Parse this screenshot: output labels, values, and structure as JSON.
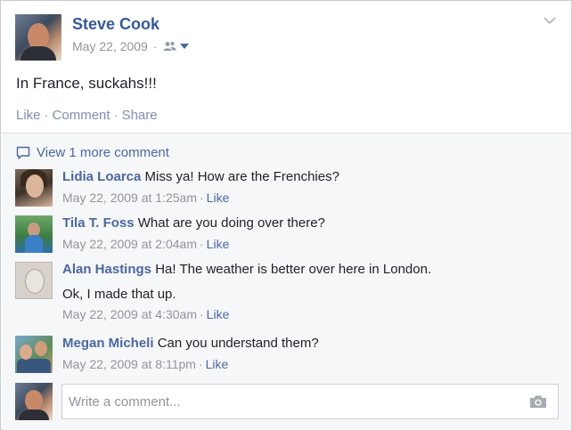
{
  "post": {
    "author": "Steve Cook",
    "date": "May 22, 2009",
    "separator": "·",
    "audience_icon": "friends-icon",
    "text": "In France, suckahs!!!",
    "actions": {
      "like": "Like",
      "comment": "Comment",
      "share": "Share"
    }
  },
  "comments": {
    "view_more": "View 1 more comment",
    "items": [
      {
        "name": "Lidia Loarca",
        "text": "Miss ya! How are the Frenchies?",
        "extra": "",
        "time": "May 22, 2009 at 1:25am",
        "like": "Like"
      },
      {
        "name": "Tila T. Foss",
        "text": "What are you doing over there?",
        "extra": "",
        "time": "May 22, 2009 at 2:04am",
        "like": "Like"
      },
      {
        "name": "Alan Hastings",
        "text": "Ha! The weather is better over here in London.",
        "extra": "Ok, I made that up.",
        "time": "May 22, 2009 at 4:30am",
        "like": "Like"
      },
      {
        "name": "Megan Micheli",
        "text": "Can you understand them?",
        "extra": "",
        "time": "May 22, 2009 at 8:11pm",
        "like": "Like"
      }
    ]
  },
  "composer": {
    "placeholder": "Write a comment..."
  },
  "colors": {
    "link": "#365899",
    "comment_link": "#4b67a1",
    "muted": "#90949c",
    "comments_bg": "#f6f7f9"
  }
}
